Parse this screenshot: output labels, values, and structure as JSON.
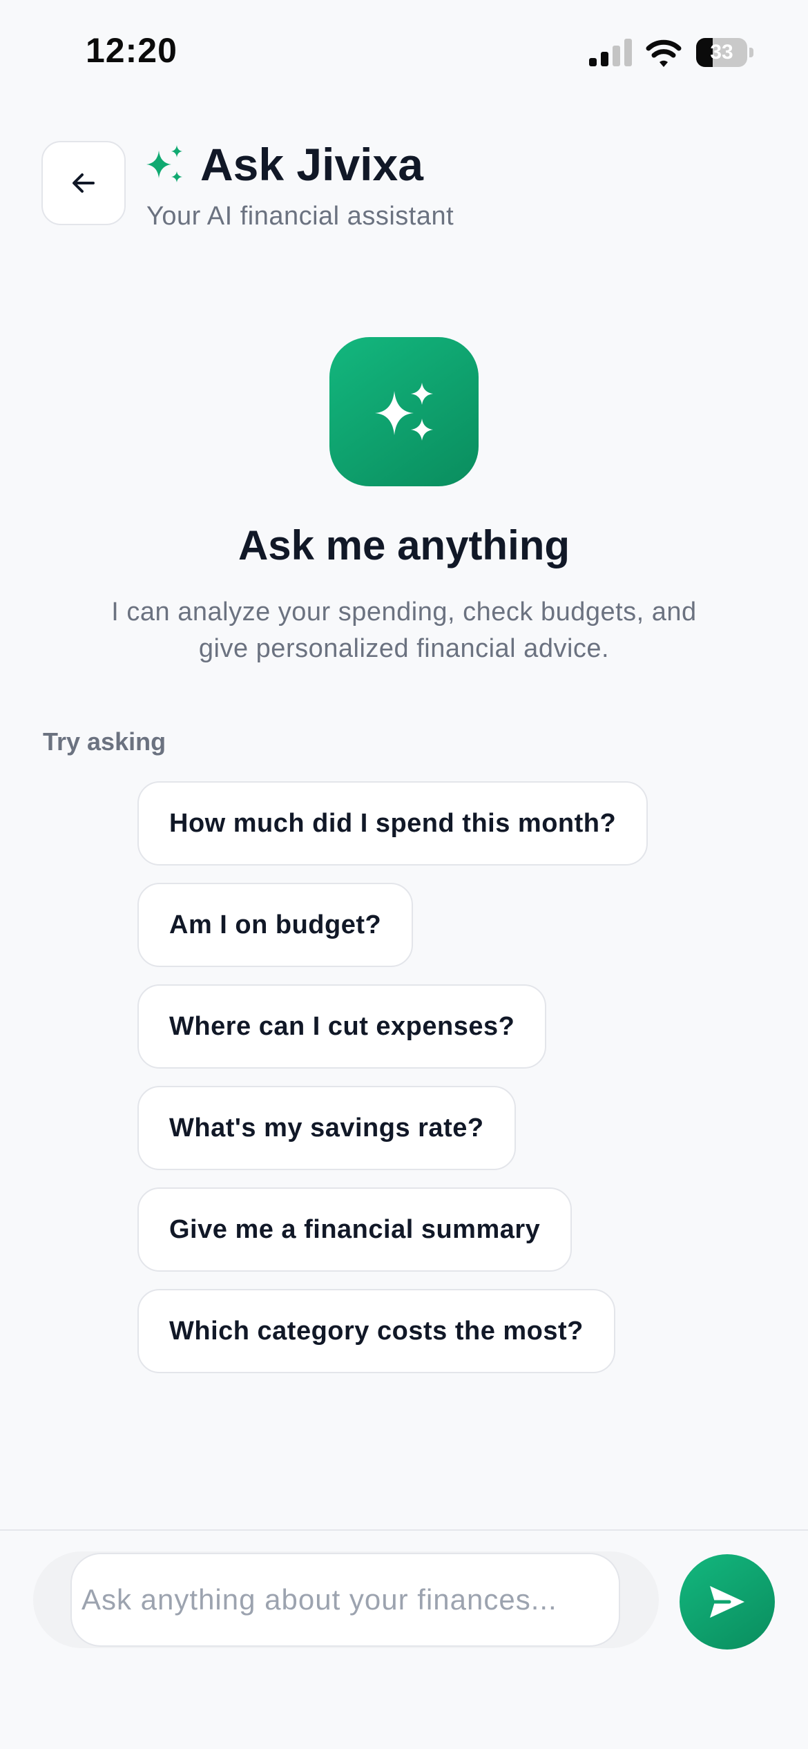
{
  "status_bar": {
    "time": "12:20",
    "battery_level": "33",
    "battery_fraction": 0.33
  },
  "header": {
    "back_icon": "arrow-left-icon",
    "title_icon": "sparkles-icon",
    "title": "Ask Jivixa",
    "subtitle": "Your AI financial assistant"
  },
  "hero": {
    "icon": "sparkles-icon",
    "title": "Ask me anything",
    "description": "I can analyze your spending, check budgets, and give personalized financial advice."
  },
  "suggestions": {
    "label": "Try asking",
    "items": [
      "How much did I spend this month?",
      "Am I on budget?",
      "Where can I cut expenses?",
      "What's my savings rate?",
      "Give me a financial summary",
      "Which category costs the most?"
    ]
  },
  "composer": {
    "placeholder": "Ask anything about your finances...",
    "value": "",
    "send_icon": "send-icon"
  },
  "colors": {
    "accent": "#10A971",
    "accent_dark": "#0A8D5E",
    "background": "#F8F9FB",
    "text_primary": "#111827",
    "text_secondary": "#6B7280",
    "border": "#E3E5EA"
  }
}
